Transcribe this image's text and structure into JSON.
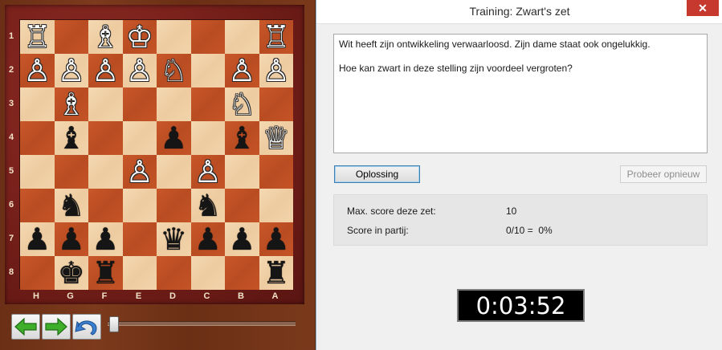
{
  "board": {
    "ranks": [
      "1",
      "2",
      "3",
      "4",
      "5",
      "6",
      "7",
      "8"
    ],
    "files": [
      "H",
      "G",
      "F",
      "E",
      "D",
      "C",
      "B",
      "A"
    ],
    "squares": [
      [
        {
          "p": "♖",
          "c": "w"
        },
        {
          "p": "",
          "c": ""
        },
        {
          "p": "♗",
          "c": "w"
        },
        {
          "p": "♔",
          "c": "w"
        },
        {
          "p": "",
          "c": ""
        },
        {
          "p": "",
          "c": ""
        },
        {
          "p": "",
          "c": ""
        },
        {
          "p": "♖",
          "c": "w"
        }
      ],
      [
        {
          "p": "♙",
          "c": "w"
        },
        {
          "p": "♙",
          "c": "w"
        },
        {
          "p": "♙",
          "c": "w"
        },
        {
          "p": "♙",
          "c": "w"
        },
        {
          "p": "♘",
          "c": "w"
        },
        {
          "p": "",
          "c": ""
        },
        {
          "p": "♙",
          "c": "w"
        },
        {
          "p": "♙",
          "c": "w"
        }
      ],
      [
        {
          "p": "",
          "c": ""
        },
        {
          "p": "♗",
          "c": "w"
        },
        {
          "p": "",
          "c": ""
        },
        {
          "p": "",
          "c": ""
        },
        {
          "p": "",
          "c": ""
        },
        {
          "p": "",
          "c": ""
        },
        {
          "p": "♘",
          "c": "w"
        },
        {
          "p": "",
          "c": ""
        }
      ],
      [
        {
          "p": "",
          "c": ""
        },
        {
          "p": "♝",
          "c": "b"
        },
        {
          "p": "",
          "c": ""
        },
        {
          "p": "",
          "c": ""
        },
        {
          "p": "♟",
          "c": "b"
        },
        {
          "p": "",
          "c": ""
        },
        {
          "p": "♝",
          "c": "b"
        },
        {
          "p": "♕",
          "c": "w"
        }
      ],
      [
        {
          "p": "",
          "c": ""
        },
        {
          "p": "",
          "c": ""
        },
        {
          "p": "",
          "c": ""
        },
        {
          "p": "♙",
          "c": "w"
        },
        {
          "p": "",
          "c": ""
        },
        {
          "p": "♙",
          "c": "w"
        },
        {
          "p": "",
          "c": ""
        },
        {
          "p": "",
          "c": ""
        }
      ],
      [
        {
          "p": "",
          "c": ""
        },
        {
          "p": "♞",
          "c": "b"
        },
        {
          "p": "",
          "c": ""
        },
        {
          "p": "",
          "c": ""
        },
        {
          "p": "",
          "c": ""
        },
        {
          "p": "♞",
          "c": "b"
        },
        {
          "p": "",
          "c": ""
        },
        {
          "p": "",
          "c": ""
        }
      ],
      [
        {
          "p": "♟",
          "c": "b"
        },
        {
          "p": "♟",
          "c": "b"
        },
        {
          "p": "♟",
          "c": "b"
        },
        {
          "p": "",
          "c": ""
        },
        {
          "p": "♛",
          "c": "b"
        },
        {
          "p": "♟",
          "c": "b"
        },
        {
          "p": "♟",
          "c": "b"
        },
        {
          "p": "♟",
          "c": "b"
        }
      ],
      [
        {
          "p": "",
          "c": ""
        },
        {
          "p": "♚",
          "c": "b"
        },
        {
          "p": "♜",
          "c": "b"
        },
        {
          "p": "",
          "c": ""
        },
        {
          "p": "",
          "c": ""
        },
        {
          "p": "",
          "c": ""
        },
        {
          "p": "",
          "c": ""
        },
        {
          "p": "♜",
          "c": "b"
        }
      ]
    ]
  },
  "controls": {
    "back_icon": "arrow-left-icon",
    "forward_icon": "arrow-right-icon",
    "undo_icon": "undo-icon",
    "slider_position": 0
  },
  "dialog": {
    "title": "Training: Zwart's zet",
    "close_label": "✕",
    "question_line1": "Wit heeft zijn ontwikkeling verwaarloosd. Zijn dame staat ook ongelukkig.",
    "question_line2": "Hoe kan zwart in deze stelling zijn voordeel vergroten?",
    "solution_button": "Oplossing",
    "retry_button": "Probeer opnieuw",
    "max_score_label": "Max. score deze zet:",
    "max_score_value": "10",
    "game_score_label": "Score in partij:",
    "game_score_value": "0/10 =  0%",
    "timer": "0:03:52"
  },
  "colors": {
    "light_square": "#f0cfa5",
    "dark_square": "#c2532a",
    "close_button": "#c7382f",
    "timer_bg": "#000000"
  }
}
